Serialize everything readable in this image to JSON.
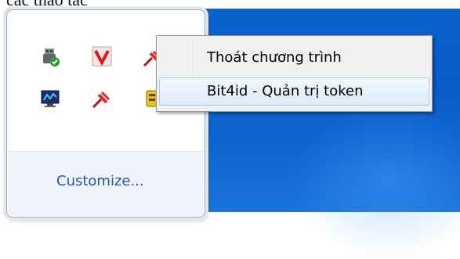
{
  "caption": {
    "text": "các thao tác"
  },
  "flyout": {
    "customize_label": "Customize...",
    "icons": [
      {
        "name": "usb-safely-remove-icon"
      },
      {
        "name": "viettel-v-icon"
      },
      {
        "name": "red-pin-icon"
      },
      {
        "name": "network-monitor-icon"
      },
      {
        "name": "red-pin-icon"
      },
      {
        "name": "token-manager-icon"
      }
    ]
  },
  "context_menu": {
    "items": [
      {
        "label": "Thoát chương trình"
      },
      {
        "label": "Bit4id - Quản trị token",
        "highlighted": true
      }
    ]
  },
  "colors": {
    "desktop": "#0b63d0",
    "link": "#1e5aa8",
    "menu_highlight": "#dcebfc"
  }
}
